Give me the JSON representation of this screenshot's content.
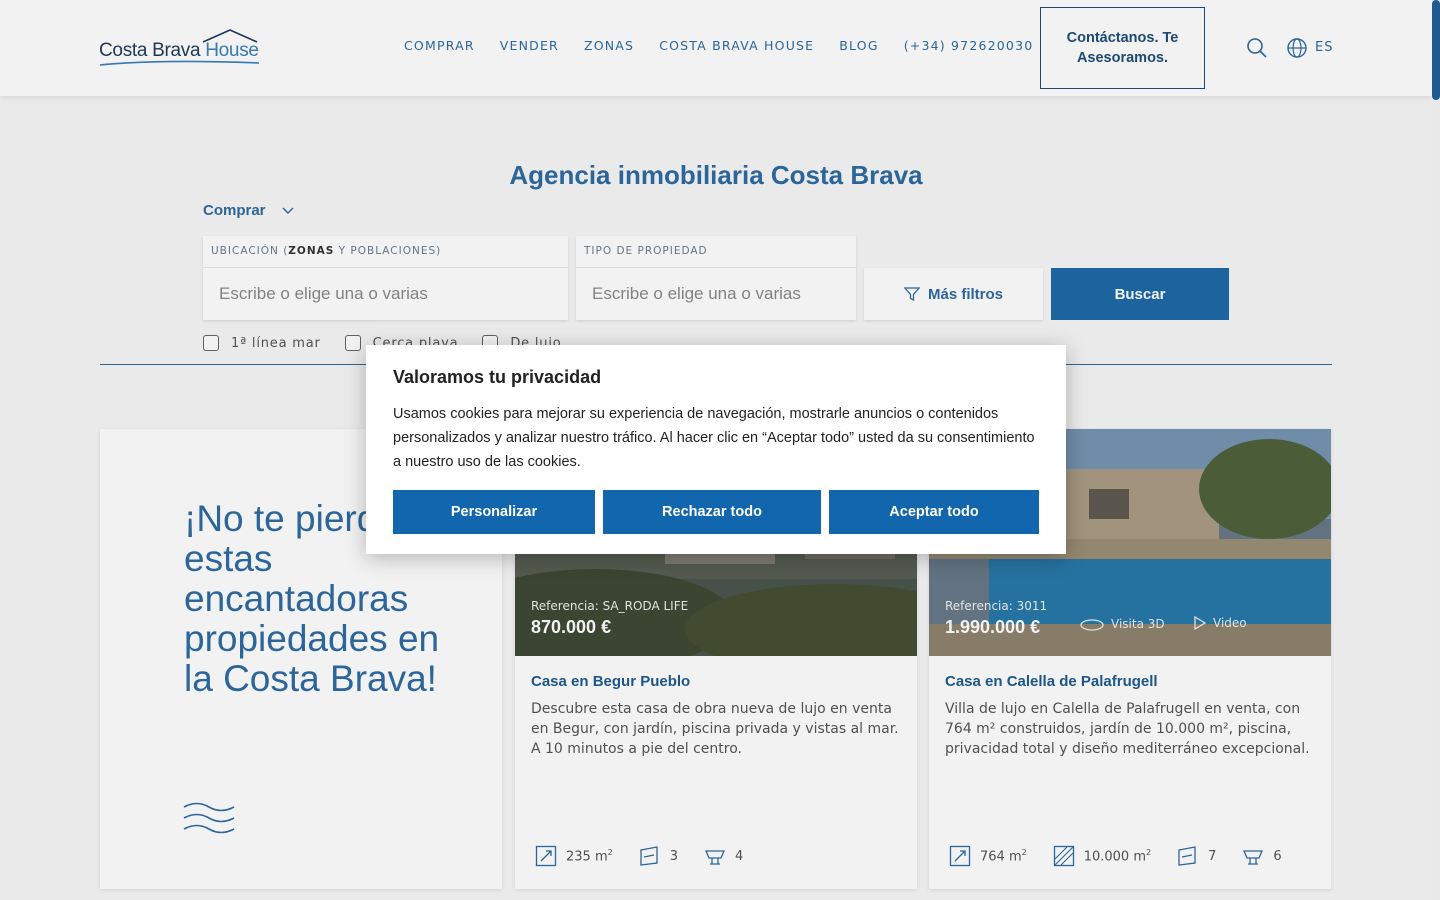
{
  "header": {
    "logo_main": "Costa Brava ",
    "logo_accent": "House",
    "nav": [
      "COMPRAR",
      "VENDER",
      "ZONAS",
      "COSTA BRAVA HOUSE",
      "BLOG",
      "(+34) 972620030"
    ],
    "contact_label": "Contáctanos. Te Asesoramos.",
    "language": "ES"
  },
  "search": {
    "title": "Agencia inmobiliaria Costa Brava",
    "mode": "Comprar",
    "location_label_a": "UBICACIÓN (",
    "location_label_b": "ZONAS",
    "location_label_c": " Y POBLACIONES)",
    "location_placeholder": "Escribe o elige una o varias",
    "type_label": "TIPO DE PROPIEDAD",
    "type_placeholder": "Escribe o elige una o varias",
    "more_filters": "Más filtros",
    "search_button": "Buscar",
    "checkboxes": [
      "1ª línea mar",
      "Cerca playa",
      "De lujo"
    ]
  },
  "promo": {
    "text": "¡No te pierdas estas encantadoras propiedades en la Costa Brava!"
  },
  "properties": [
    {
      "reference": "Referencia: SA_RODA LIFE",
      "price": "870.000 €",
      "title": "Casa en Begur Pueblo",
      "description": "Descubre esta casa de obra nueva de lujo en venta en Begur, con jardín, piscina privada y vistas al mar. A 10 minutos a pie del centro.",
      "area": "235 m",
      "bedrooms": "3",
      "bathrooms": "4"
    },
    {
      "reference": "Referencia: 3011",
      "price": "1.990.000 €",
      "title": "Casa en Calella de Palafrugell",
      "description": "Villa de lujo en Calella de Palafrugell en venta, con 764 m² construidos, jardín de 10.000 m², piscina, privacidad total y diseño mediterráneo excepcional.",
      "visit3d": "Visita 3D",
      "video": "Video",
      "area": "764 m",
      "plot": "10.000 m",
      "bedrooms": "7",
      "bathrooms": "6"
    }
  ],
  "cookie": {
    "title": "Valoramos tu privacidad",
    "text": "Usamos cookies para mejorar su experiencia de navegación, mostrarle anuncios o contenidos personalizados y analizar nuestro tráfico. Al hacer clic en “Aceptar todo” usted da su consentimiento a nuestro uso de las cookies.",
    "customize": "Personalizar",
    "reject": "Rechazar todo",
    "accept": "Aceptar todo"
  },
  "colors": {
    "brand": "#2f6ba3",
    "primary_button": "#1266ad",
    "search_button": "#1f6aa8"
  }
}
